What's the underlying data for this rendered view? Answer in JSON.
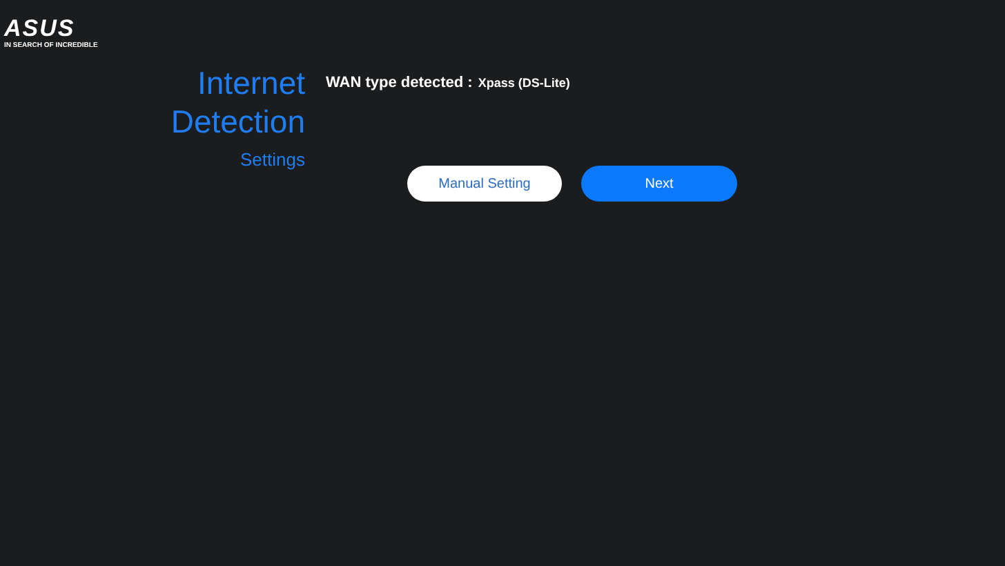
{
  "logo": {
    "brand": "ASUS",
    "tagline": "IN SEARCH OF INCREDIBLE"
  },
  "heading": {
    "lines": [
      "Internet",
      "Detection"
    ],
    "subtitle": "Settings"
  },
  "detection": {
    "label": "WAN type detected :",
    "value": "Xpass (DS-Lite)"
  },
  "buttons": [
    {
      "label": "Manual Setting",
      "kind": "secondary"
    },
    {
      "label": "Next",
      "kind": "primary"
    }
  ]
}
